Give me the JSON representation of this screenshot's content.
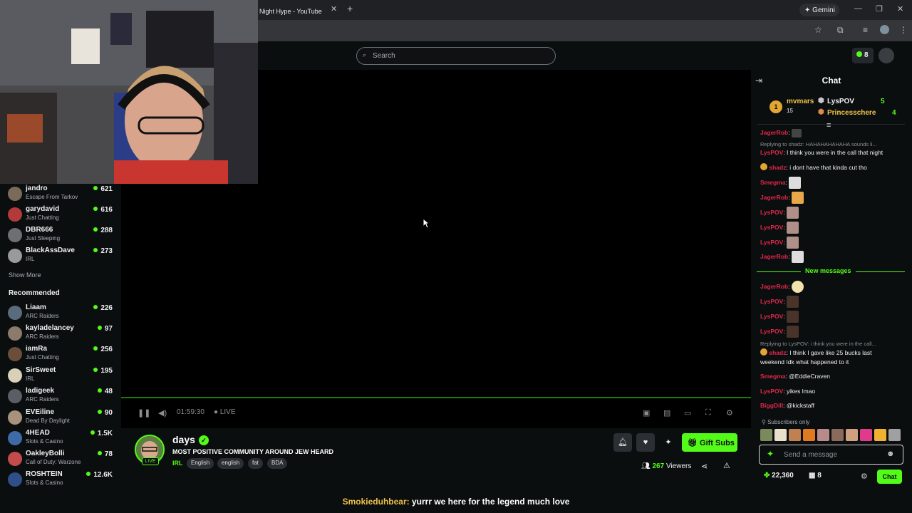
{
  "browser": {
    "tab_title": "Night Hype - YouTube",
    "gemini_label": "Gemini"
  },
  "header": {
    "search_placeholder": "Search",
    "kick_count": "8"
  },
  "sidebar": {
    "following": [
      {
        "name": "jandro",
        "category": "Escape From Tarkov",
        "viewers": "621"
      },
      {
        "name": "garydavid",
        "category": "Just Chatting",
        "viewers": "616"
      },
      {
        "name": "DBR666",
        "category": "Just Sleeping",
        "viewers": "288"
      },
      {
        "name": "BlackAssDave",
        "category": "IRL",
        "viewers": "273"
      }
    ],
    "show_more": "Show More",
    "recommended_heading": "Recommended",
    "recommended": [
      {
        "name": "Liaam",
        "category": "ARC Raiders",
        "viewers": "226"
      },
      {
        "name": "kayladelancey",
        "category": "ARC Raiders",
        "viewers": "97"
      },
      {
        "name": "iamRa",
        "category": "Just Chatting",
        "viewers": "256"
      },
      {
        "name": "SirSweet",
        "category": "IRL",
        "viewers": "195"
      },
      {
        "name": "ladigeek",
        "category": "ARC Raiders",
        "viewers": "48"
      },
      {
        "name": "EVEiline",
        "category": "Dead By Daylight",
        "viewers": "90"
      },
      {
        "name": "4HEAD",
        "category": "Slots & Casino",
        "viewers": "1.5K"
      },
      {
        "name": "OakleyBolli",
        "category": "Call of Duty: Warzone",
        "viewers": "78"
      },
      {
        "name": "ROSHTEIN",
        "category": "Slots & Casino",
        "viewers": "12.6K"
      }
    ]
  },
  "player": {
    "uptime": "01:59:30",
    "live_label": "LIVE"
  },
  "stream": {
    "streamer": "days",
    "live_badge": "LIVE",
    "title": "MOST POSITIVE COMMUNITY AROUND JEW HEARD",
    "category": "IRL",
    "tags": [
      "English",
      "english",
      "fat",
      "BDA"
    ],
    "gift_label": "Gift Subs",
    "viewer_count": "267",
    "viewers_label": "Viewers"
  },
  "caption": {
    "user": "Smokieduhbear:",
    "text": "yurrr we here for the legend much love"
  },
  "chat": {
    "title": "Chat",
    "leaderboard": [
      {
        "rank": "1",
        "name": "mvmars",
        "count": "15"
      },
      {
        "name": "LysPOV",
        "count": "5"
      },
      {
        "name": "Princesschere",
        "count": "4"
      }
    ],
    "messages": [
      {
        "user": "JagerRob",
        "text": ""
      },
      {
        "reply": "Replying to shadz: HAHAHAHAHAHA sounds li..."
      },
      {
        "user": "LysPOV",
        "text": "I think you were in the call that night"
      },
      {
        "user": "shadz",
        "text": "i dont have that kinda cut tho"
      },
      {
        "user": "Smegma",
        "text": ""
      },
      {
        "user": "JagerRob",
        "text": ""
      },
      {
        "user": "LysPOV",
        "text": ""
      },
      {
        "user": "LysPOV",
        "text": ""
      },
      {
        "user": "LysPOV",
        "text": ""
      },
      {
        "user": "JagerRob",
        "text": ""
      }
    ],
    "new_messages": "New messages",
    "messages2": [
      {
        "user": "JagerRob",
        "text": ""
      },
      {
        "user": "LysPOV",
        "text": ""
      },
      {
        "user": "LysPOV",
        "text": ""
      },
      {
        "user": "LysPOV",
        "text": ""
      },
      {
        "reply": "Replying to LysPOV: i think you were in the call..."
      },
      {
        "user": "shadz",
        "text": "I think I gave like 25 bucks last"
      },
      {
        "cont": "weekend Idk what happened to it"
      },
      {
        "user": "Smegma",
        "text": "@EddieCraven"
      },
      {
        "user": "LysPOV",
        "text": "yikes lmao"
      },
      {
        "user": "BiggDill",
        "text": "@kickstaff"
      }
    ],
    "subs_only": "Subscribers only",
    "input_placeholder": "Send a message",
    "points": "22,360",
    "prediction_count": "8",
    "chat_button": "Chat"
  },
  "colors": {
    "accent": "#53fc18",
    "username": "#e1274b"
  }
}
